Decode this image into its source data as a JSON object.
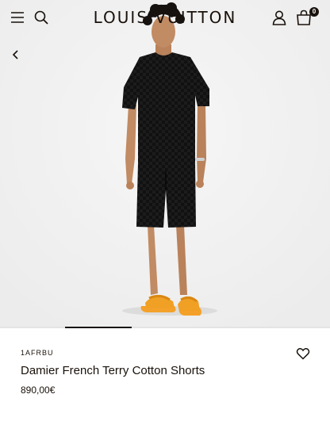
{
  "header": {
    "brand": "LOUIS VUITTON",
    "bag_count": "0",
    "icons": {
      "menu": "menu-icon",
      "search": "search-icon",
      "account": "account-icon",
      "bag": "shopping-bag-icon",
      "back": "chevron-left-icon"
    }
  },
  "product": {
    "sku": "1AFRBU",
    "name": "Damier French Terry Cotton Shorts",
    "price": "890,00€"
  },
  "gallery": {
    "active_index": 2
  },
  "colors": {
    "brand_text": "#19110b",
    "sandal": "#f3a12a",
    "outfit": "#111111"
  }
}
